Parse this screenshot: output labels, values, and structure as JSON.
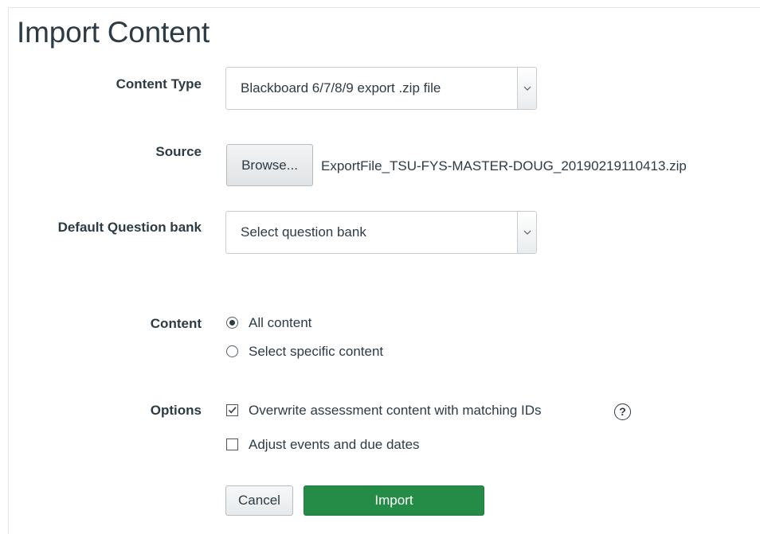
{
  "page": {
    "title": "Import Content"
  },
  "form": {
    "content_type": {
      "label": "Content Type",
      "selected": "Blackboard 6/7/8/9 export .zip file"
    },
    "source": {
      "label": "Source",
      "browse_label": "Browse...",
      "file_name": "ExportFile_TSU-FYS-MASTER-DOUG_20190219110413.zip"
    },
    "question_bank": {
      "label": "Default Question bank",
      "selected": "Select question bank"
    },
    "content": {
      "label": "Content",
      "options": [
        {
          "label": "All content",
          "selected": true
        },
        {
          "label": "Select specific content",
          "selected": false
        }
      ]
    },
    "options": {
      "label": "Options",
      "items": [
        {
          "label": "Overwrite assessment content with matching IDs",
          "checked": true,
          "help": true
        },
        {
          "label": "Adjust events and due dates",
          "checked": false
        }
      ],
      "help_glyph": "?"
    }
  },
  "actions": {
    "cancel_label": "Cancel",
    "import_label": "Import",
    "import_color": "#258c48"
  }
}
